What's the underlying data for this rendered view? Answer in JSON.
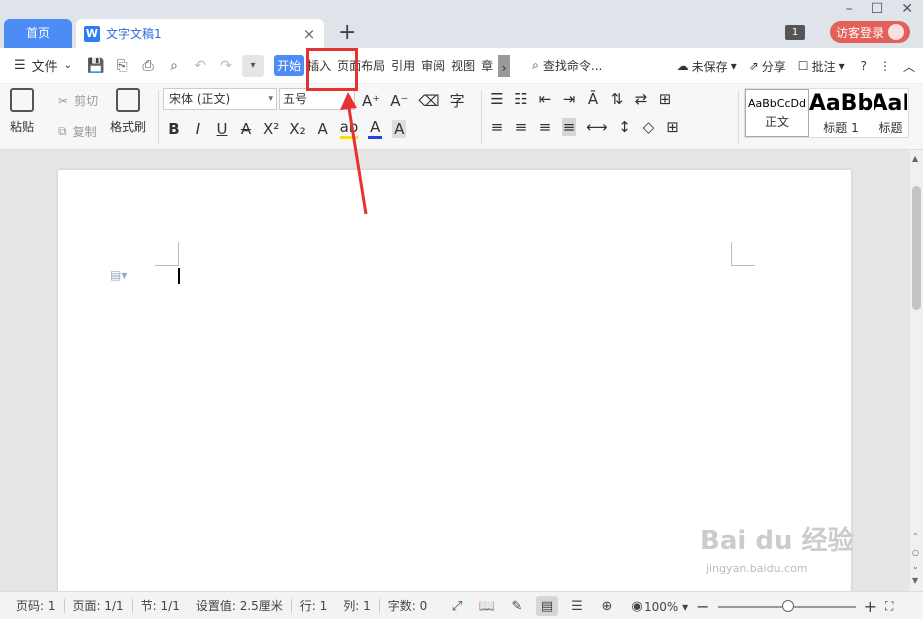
{
  "titlebar": {
    "home_tab": "首页",
    "doc_tab": "文字文稿1",
    "doc_icon_letter": "W",
    "close": "×",
    "add": "+",
    "badge": "1",
    "login": "访客登录"
  },
  "menubar": {
    "file": "文件",
    "tabs": [
      "开始",
      "插入",
      "页面布局",
      "引用",
      "审阅",
      "视图",
      "章"
    ],
    "search": "查找命令...",
    "unsaved": "未保存",
    "share": "分享",
    "comment": "批注"
  },
  "ribbon": {
    "paste": "粘贴",
    "cut": "剪切",
    "copy": "复制",
    "format_painter": "格式刷",
    "font": "宋体 (正文)",
    "size": "五号",
    "styles": [
      {
        "sample": "AaBbCcDd",
        "name": "正文"
      },
      {
        "sample": "AaBb",
        "name": "标题 1"
      },
      {
        "sample": "AaI",
        "name": "标题"
      }
    ]
  },
  "watermark": {
    "main": "Bai du 经验",
    "sub": "jingyan.baidu.com"
  },
  "status": {
    "page_num": "页码: 1",
    "pages": "页面: 1/1",
    "section": "节: 1/1",
    "setting": "设置值: 2.5厘米",
    "row": "行: 1",
    "col": "列: 1",
    "words": "字数: 0",
    "zoom": "100%",
    "zoom_percent": 100
  }
}
